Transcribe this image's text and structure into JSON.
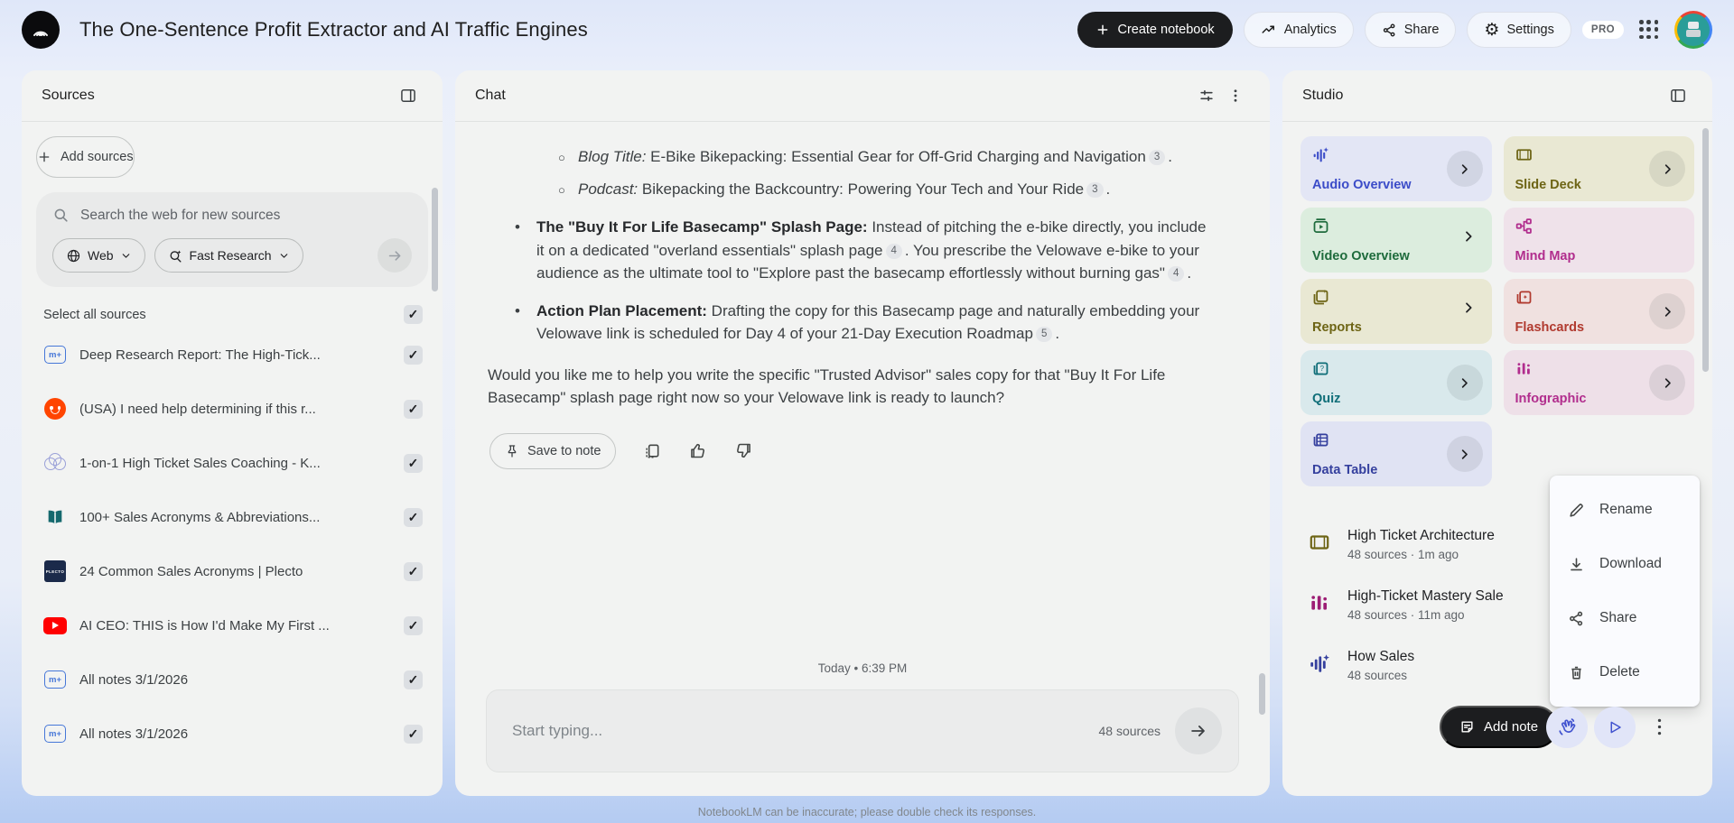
{
  "header": {
    "app_title": "The One-Sentence Profit Extractor and AI Traffic Engines",
    "create_notebook": "Create notebook",
    "analytics": "Analytics",
    "share": "Share",
    "settings": "Settings",
    "pro_badge": "PRO"
  },
  "sources": {
    "panel_title": "Sources",
    "add_button": "Add sources",
    "search_placeholder": "Search the web for new sources",
    "web_filter": "Web",
    "research_mode": "Fast Research",
    "select_all": "Select all sources",
    "items": [
      {
        "title": "Deep Research Report: The High-Tick...",
        "icon": "notebook-doc"
      },
      {
        "title": "(USA) I need help determining if this r...",
        "icon": "reddit"
      },
      {
        "title": "1-on-1 High Ticket Sales Coaching - K...",
        "icon": "venn-circles"
      },
      {
        "title": "100+ Sales Acronyms & Abbreviations...",
        "icon": "book"
      },
      {
        "title": "24 Common Sales Acronyms | Plecto",
        "icon": "plecto"
      },
      {
        "title": "AI CEO: THIS is How I'd Make My First ...",
        "icon": "youtube"
      },
      {
        "title": "All notes 3/1/2026",
        "icon": "notebook-doc"
      },
      {
        "title": "All notes 3/1/2026",
        "icon": "notebook-doc"
      }
    ]
  },
  "chat": {
    "panel_title": "Chat",
    "sub_bullets": [
      {
        "label": "Blog Title:",
        "text": " E-Bike Bikepacking: Essential Gear for Off-Grid Charging and Navigation",
        "citation": "3",
        "period": "."
      },
      {
        "label": "Podcast:",
        "text": " Bikepacking the Backcountry: Powering Your Tech and Your Ride",
        "citation": "3",
        "period": "."
      }
    ],
    "bullet_basecamp": {
      "label": "The \"Buy It For Life Basecamp\" Splash Page:",
      "text1": " Instead of pitching the e-bike directly, you include it on a dedicated \"overland essentials\" splash page",
      "citation1": "4",
      "text2": ". You prescribe the Velowave e-bike to your audience as the ultimate tool to \"Explore past the basecamp effortlessly without burning gas\"",
      "citation2": "4",
      "period": "."
    },
    "bullet_action_plan": {
      "label": "Action Plan Placement:",
      "text": " Drafting the copy for this Basecamp page and naturally embedding your Velowave link is scheduled for Day 4 of your 21-Day Execution Roadmap",
      "citation": "5",
      "period": "."
    },
    "closing": "Would you like me to help you write the specific \"Trusted Advisor\" sales copy for that \"Buy It For Life Basecamp\" splash page right now so your Velowave link is ready to launch?",
    "save_to_note": "Save to note",
    "date_label": "Today • 6:39 PM",
    "input_placeholder": "Start typing...",
    "source_count": "48 sources",
    "disclaimer": "NotebookLM can be inaccurate; please double check its responses."
  },
  "studio": {
    "panel_title": "Studio",
    "tiles": [
      {
        "label": "Audio Overview",
        "color": "#3b4cc8",
        "bg": "#e3e6f5"
      },
      {
        "label": "Slide Deck",
        "color": "#6d6414",
        "bg": "#e9e8d3"
      },
      {
        "label": "Video Overview",
        "color": "#1e6b3c",
        "bg": "#dcedde"
      },
      {
        "label": "Mind Map",
        "color": "#b12d8d",
        "bg": "#efe2ea"
      },
      {
        "label": "Reports",
        "color": "#6d6414",
        "bg": "#e9e8d3"
      },
      {
        "label": "Flashcards",
        "color": "#b13a2f",
        "bg": "#f0e1e0"
      },
      {
        "label": "Quiz",
        "color": "#0f6e78",
        "bg": "#d9e9ec"
      },
      {
        "label": "Infographic",
        "color": "#b12d8d",
        "bg": "#eee0e8"
      },
      {
        "label": "Data Table",
        "color": "#35409e",
        "bg": "#e0e3f3"
      }
    ],
    "notes": [
      {
        "title": "High Ticket Architecture",
        "meta": "48 sources · 1m ago",
        "icon": "slide-deck"
      },
      {
        "title": "High-Ticket Mastery Sale",
        "meta": "48 sources · 11m ago",
        "icon": "infographic"
      },
      {
        "title": "How Sales",
        "meta": "48 sources",
        "icon": "audio-waveform"
      }
    ],
    "add_note": "Add note"
  },
  "context_menu": {
    "rename": "Rename",
    "download": "Download",
    "share": "Share",
    "delete": "Delete"
  }
}
